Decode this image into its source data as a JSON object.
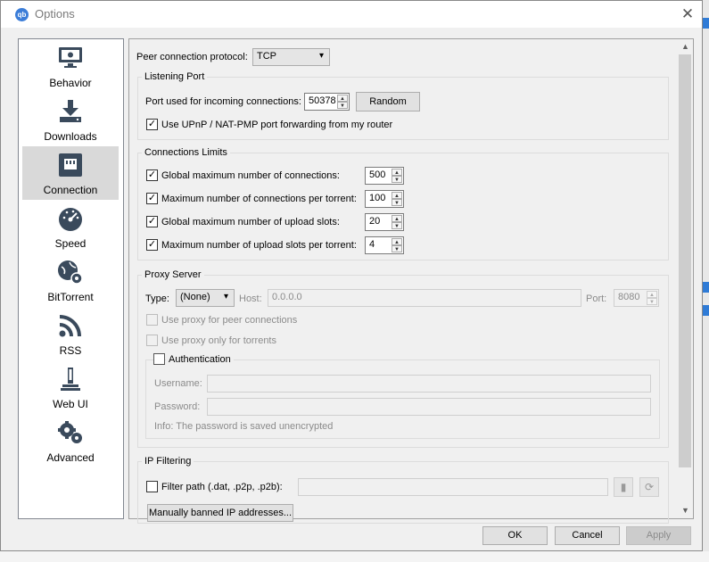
{
  "window": {
    "title": "Options",
    "app_icon_text": "qb",
    "close_glyph": "✕"
  },
  "sidebar": {
    "items": [
      {
        "label": "Behavior",
        "icon": "behavior-monitor-icon"
      },
      {
        "label": "Downloads",
        "icon": "download-icon"
      },
      {
        "label": "Connection",
        "icon": "network-icon",
        "selected": true
      },
      {
        "label": "Speed",
        "icon": "speedometer-icon"
      },
      {
        "label": "BitTorrent",
        "icon": "globe-gear-icon"
      },
      {
        "label": "RSS",
        "icon": "rss-icon"
      },
      {
        "label": "Web UI",
        "icon": "web-ui-icon"
      },
      {
        "label": "Advanced",
        "icon": "gears-icon"
      }
    ]
  },
  "protocol": {
    "label": "Peer connection protocol:",
    "value": "TCP"
  },
  "listening": {
    "title": "Listening Port",
    "port_label": "Port used for incoming connections:",
    "port_value": "50378",
    "random_button": "Random",
    "upnp_label": "Use UPnP / NAT-PMP port forwarding from my router",
    "upnp_checked": true
  },
  "limits": {
    "title": "Connections Limits",
    "rows": [
      {
        "label": "Global maximum number of connections:",
        "value": "500",
        "checked": true
      },
      {
        "label": "Maximum number of connections per torrent:",
        "value": "100",
        "checked": true
      },
      {
        "label": "Global maximum number of upload slots:",
        "value": "20",
        "checked": true
      },
      {
        "label": "Maximum number of upload slots per torrent:",
        "value": "4",
        "checked": true
      }
    ]
  },
  "proxy": {
    "title": "Proxy Server",
    "type_label": "Type:",
    "type_value": "(None)",
    "host_label": "Host:",
    "host_value": "0.0.0.0",
    "port_label": "Port:",
    "port_value": "8080",
    "peer_label": "Use proxy for peer connections",
    "torrents_label": "Use proxy only for torrents",
    "auth_title": "Authentication",
    "username_label": "Username:",
    "password_label": "Password:",
    "info": "Info: The password is saved unencrypted"
  },
  "ipfilter": {
    "title": "IP Filtering",
    "filter_label": "Filter path (.dat, .p2p, .p2b):",
    "banned_button": "Manually banned IP addresses..."
  },
  "footer": {
    "ok": "OK",
    "cancel": "Cancel",
    "apply": "Apply"
  },
  "colors": {
    "accent": "#3b7dd8",
    "selected_bg": "#d9d9d9",
    "window_bg": "#f0f0f0"
  }
}
